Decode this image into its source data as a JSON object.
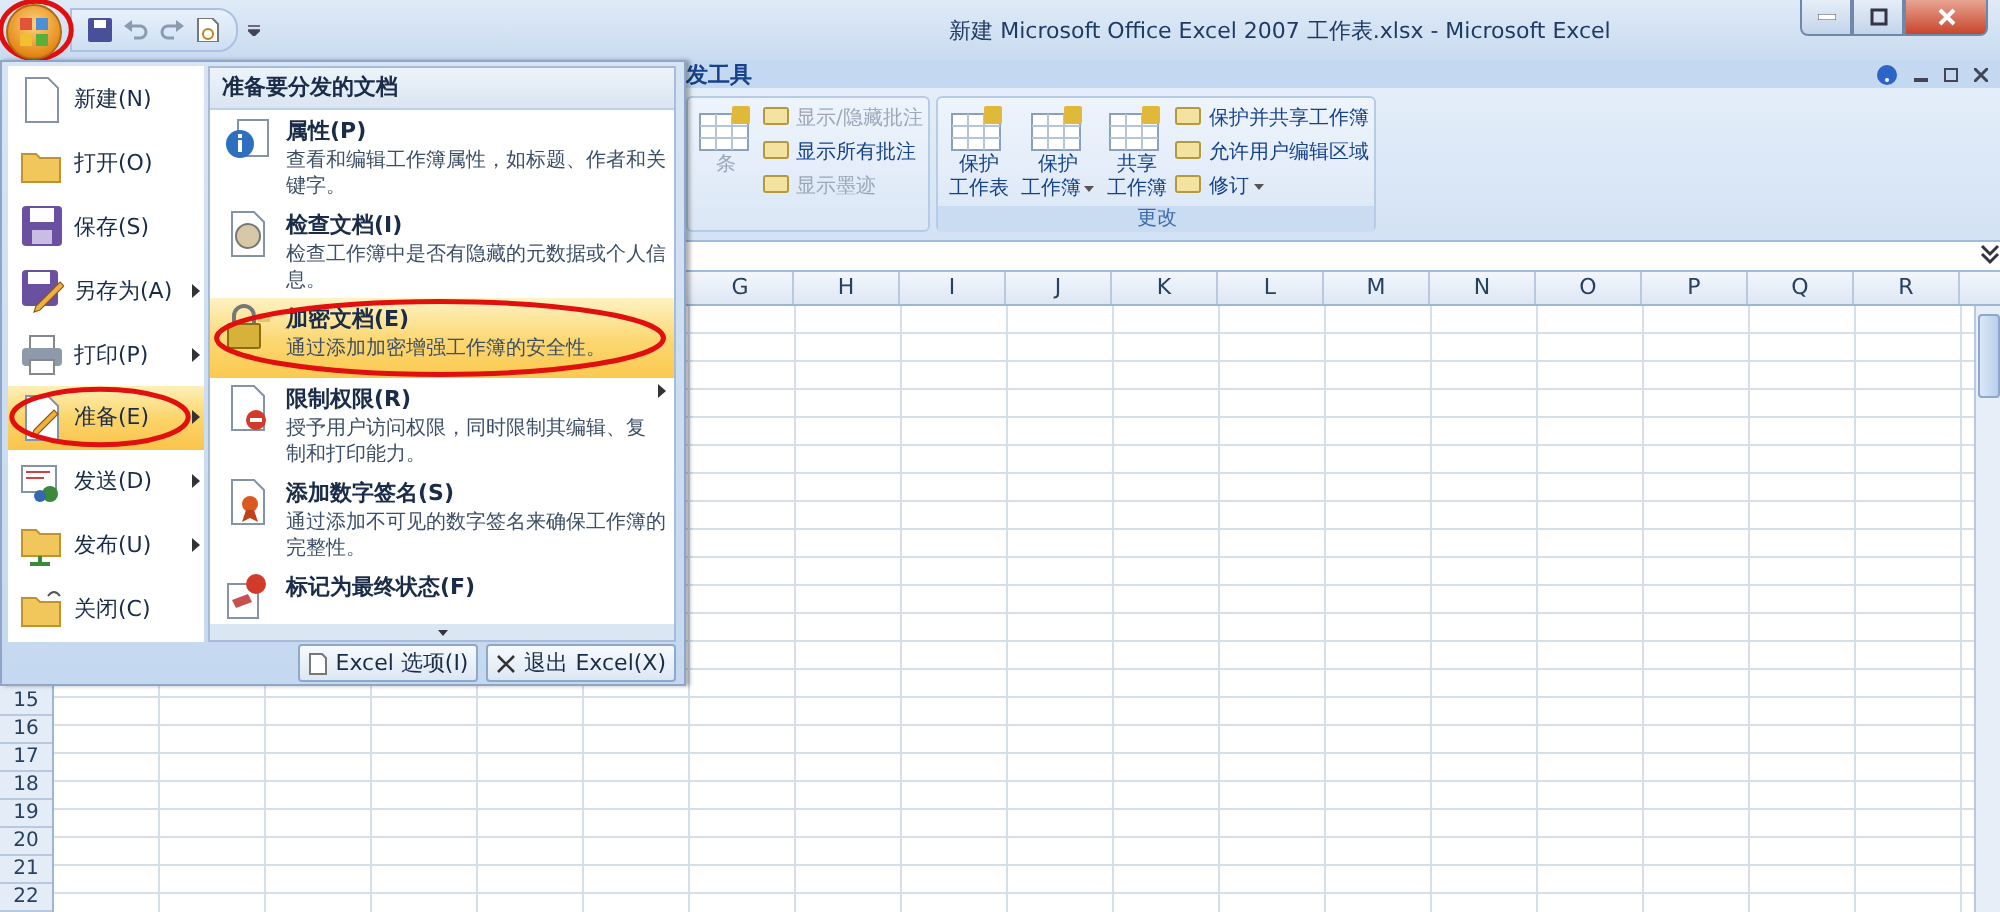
{
  "window": {
    "title": "新建 Microsoft Office Excel 2007 工作表.xlsx - Microsoft Excel"
  },
  "office_button": {
    "circled": true
  },
  "ribbon": {
    "tab_fragment": "发工具",
    "groups": [
      {
        "items": [
          {
            "kind": "large",
            "lines": [
              "条"
            ],
            "disabled": true,
            "dropdown": false
          },
          {
            "kind": "small",
            "lines": [
              "显示/隐藏批注"
            ],
            "disabled": true,
            "dropdown": false
          },
          {
            "kind": "small",
            "lines": [
              "显示所有批注"
            ],
            "disabled": false,
            "dropdown": false
          },
          {
            "kind": "small",
            "lines": [
              "显示墨迹"
            ],
            "disabled": true,
            "dropdown": false
          }
        ]
      },
      {
        "label": "更改",
        "items": [
          {
            "kind": "large",
            "lines": [
              "保护",
              "工作表"
            ],
            "disabled": false,
            "dropdown": false
          },
          {
            "kind": "large",
            "lines": [
              "保护",
              "工作簿"
            ],
            "disabled": false,
            "dropdown": true
          },
          {
            "kind": "large",
            "lines": [
              "共享",
              "工作簿"
            ],
            "disabled": false,
            "dropdown": false
          },
          {
            "kind": "small",
            "lines": [
              "保护并共享工作簿"
            ],
            "disabled": false,
            "dropdown": false
          },
          {
            "kind": "small",
            "lines": [
              "允许用户编辑区域"
            ],
            "disabled": false,
            "dropdown": false
          },
          {
            "kind": "small",
            "lines": [
              "修订"
            ],
            "disabled": false,
            "dropdown": true
          }
        ]
      }
    ]
  },
  "sheet": {
    "columns": [
      "G",
      "H",
      "I",
      "J",
      "K",
      "L",
      "M",
      "N",
      "O",
      "P",
      "Q",
      "R"
    ],
    "rows": [
      "15",
      "16",
      "17",
      "18",
      "19",
      "20",
      "21",
      "22"
    ]
  },
  "menu": {
    "commands": [
      {
        "label": "新建(N)",
        "submenu": false,
        "selected": false,
        "circled": false
      },
      {
        "label": "打开(O)",
        "submenu": false,
        "selected": false,
        "circled": false
      },
      {
        "label": "保存(S)",
        "submenu": false,
        "selected": false,
        "circled": false
      },
      {
        "label": "另存为(A)",
        "submenu": true,
        "selected": false,
        "circled": false
      },
      {
        "label": "打印(P)",
        "submenu": true,
        "selected": false,
        "circled": false
      },
      {
        "label": "准备(E)",
        "submenu": true,
        "selected": true,
        "circled": true
      },
      {
        "label": "发送(D)",
        "submenu": true,
        "selected": false,
        "circled": false
      },
      {
        "label": "发布(U)",
        "submenu": true,
        "selected": false,
        "circled": false
      },
      {
        "label": "关闭(C)",
        "submenu": false,
        "selected": false,
        "circled": false
      }
    ],
    "panel": {
      "heading": "准备要分发的文档",
      "items": [
        {
          "title": "属性(P)",
          "description": "查看和编辑工作簿属性，如标题、作者和关键字。",
          "selected": false,
          "submenu": false,
          "circled": false
        },
        {
          "title": "检查文档(I)",
          "description": "检查工作簿中是否有隐藏的元数据或个人信息。",
          "selected": false,
          "submenu": false,
          "circled": false
        },
        {
          "title": "加密文档(E)",
          "description": "通过添加加密增强工作簿的安全性。",
          "selected": true,
          "submenu": false,
          "circled": true
        },
        {
          "title": "限制权限(R)",
          "description": "授予用户访问权限，同时限制其编辑、复制和打印能力。",
          "selected": false,
          "submenu": true,
          "circled": false
        },
        {
          "title": "添加数字签名(S)",
          "description": "通过添加不可见的数字签名来确保工作簿的完整性。",
          "selected": false,
          "submenu": false,
          "circled": false
        },
        {
          "title": "标记为最终状态(F)",
          "selected": false,
          "submenu": false,
          "circled": false
        }
      ]
    },
    "footer_buttons": [
      "Excel 选项(I)",
      "退出 Excel(X)"
    ]
  }
}
